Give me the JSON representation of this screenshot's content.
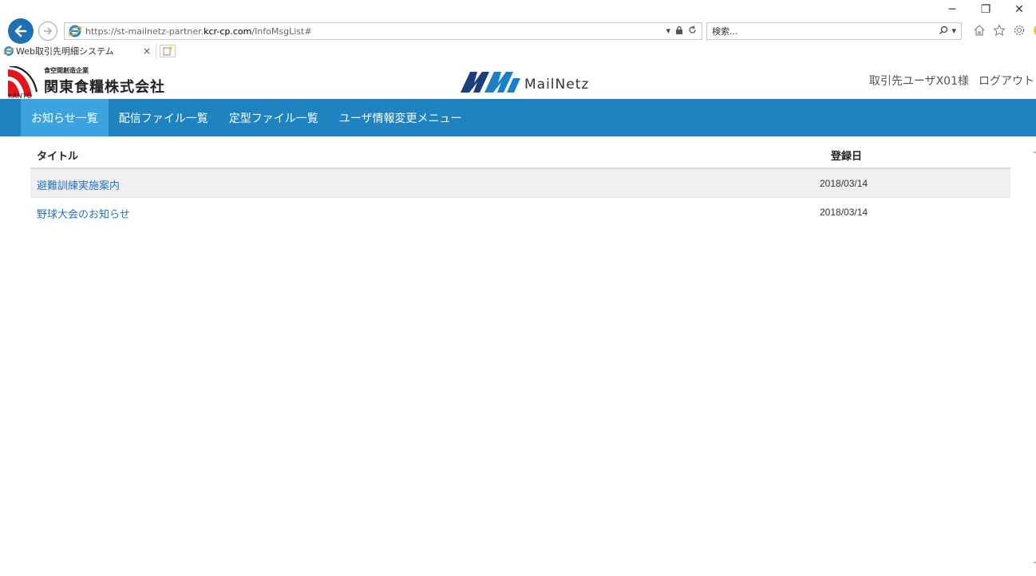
{
  "browser": {
    "url_host_prefix": "https://st-mailnetz-partner.",
    "url_host_main": "kcr-cp.com",
    "url_path": "/InfoMsgList#",
    "search_placeholder": "検索...",
    "tab_title": "Web取引先明細システム",
    "tab_close": "×",
    "win_minimize": "─",
    "win_restore": "❐",
    "win_close": "✕"
  },
  "header": {
    "company_tagline": "食空間創造企業",
    "company_name": "関東食糧株式会社",
    "company_short": "KANTO",
    "brand_name": "MailNetz",
    "user_name": "取引先ユーザX01様",
    "logout_label": "ログアウト"
  },
  "nav": {
    "items": [
      {
        "label": "お知らせ一覧"
      },
      {
        "label": "配信ファイル一覧"
      },
      {
        "label": "定型ファイル一覧"
      },
      {
        "label": "ユーザ情報変更メニュー"
      }
    ],
    "active_index": 0
  },
  "table": {
    "headers": {
      "title": "タイトル",
      "date": "登録日"
    },
    "rows": [
      {
        "title": "避難訓練実施案内",
        "date": "2018/03/14"
      },
      {
        "title": "野球大会のお知らせ",
        "date": "2018/03/14"
      }
    ]
  },
  "colors": {
    "nav_bg": "#1f83c2",
    "nav_active": "#3ba3e0",
    "link": "#2274b8",
    "brand_blue": "#1a7fc4"
  },
  "icons": [
    "back-arrow-icon",
    "forward-arrow-icon",
    "ie-logo-icon",
    "dropdown-icon",
    "lock-icon",
    "refresh-icon",
    "search-icon",
    "home-icon",
    "favorites-star-icon",
    "settings-gear-icon",
    "smiley-feedback-icon",
    "new-tab-icon"
  ]
}
